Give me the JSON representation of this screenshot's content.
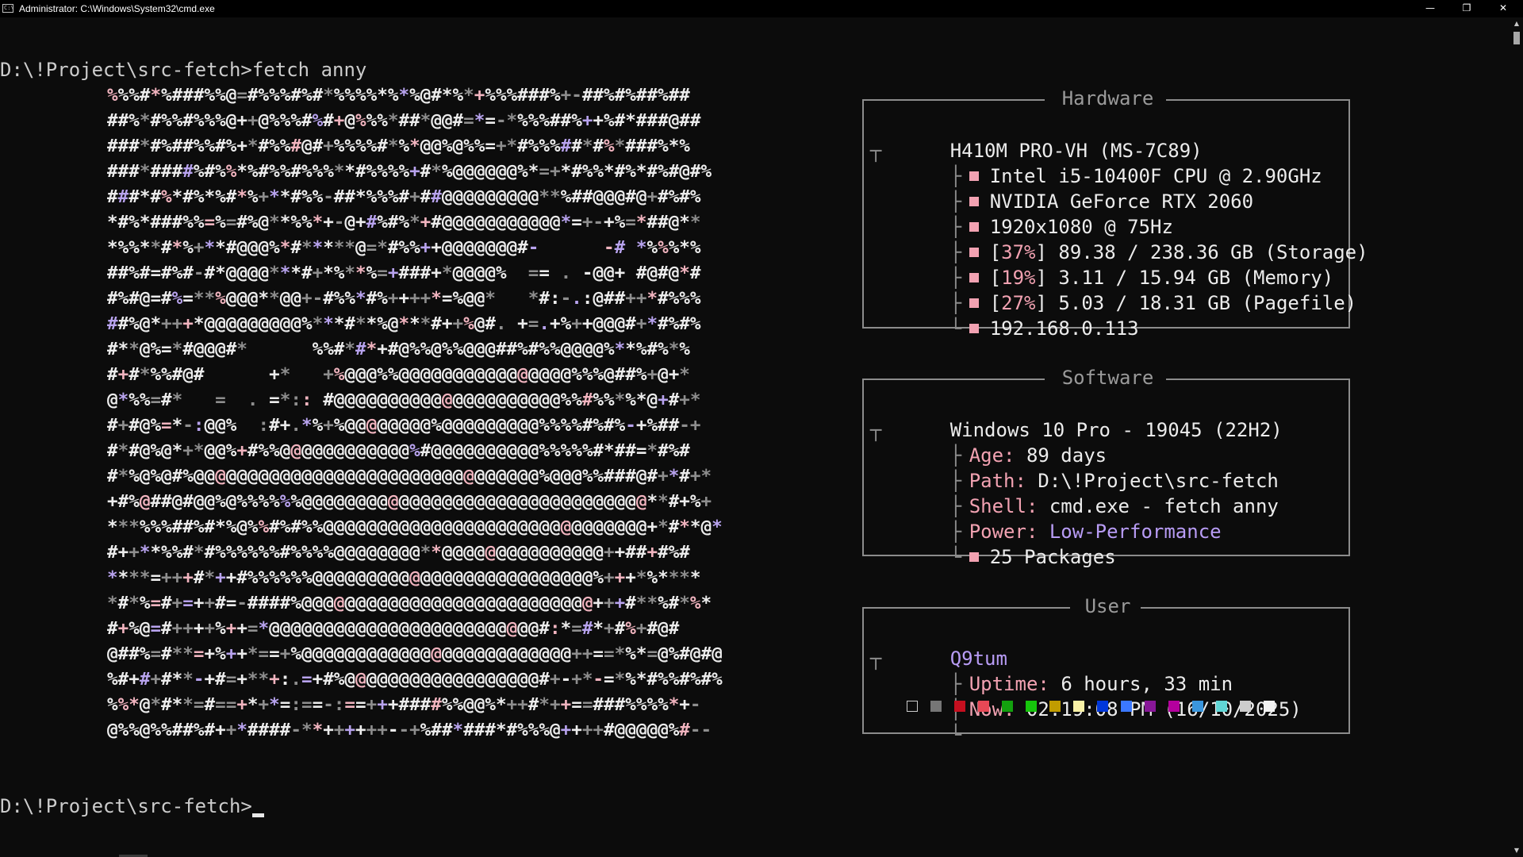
{
  "window": {
    "title": "Administrator: C:\\Windows\\System32\\cmd.exe",
    "icon_text": "C:\\",
    "minimize_icon": "minimize-icon",
    "maximize_icon": "restore-icon",
    "close_icon": "close-icon",
    "min_glyph": "—",
    "max_glyph": "❐",
    "close_glyph": "✕"
  },
  "terminal": {
    "prompt_line_1": "D:\\!Project\\src-fetch>fetch anny",
    "prompt_line_2": "D:\\!Project\\src-fetch>",
    "colors": {
      "background": "#0c0c0c",
      "text": "#cccccc",
      "pink": "#f2a2b2",
      "lavender": "#b89cf5",
      "gray": "#8c8c8c"
    }
  },
  "ascii_art": {
    "rows": [
      "%%%#*%###%%@=#%%%#%#*%%%%*%*%@#*%*+%%%###%+-##%#%##%##",
      "##%*#%%#%%%@++@%%%#%#+@%%%*##*@@#=*=-*%%%##%++%#*###@##",
      "###*#%##%%#%+*#%%#@#+%%%%#*%*@@%@%%=+*#%%%##*#%*###%*%",
      "###*####%#%%*%#%%#%%%**#%%%%+#*%@@@@@@%*=+*#%%*#%*#%#@#%",
      "###*#%*#%*%#*%+**#%%-##*%%%#+##@@@@@@@@@**%##@@@#@+#%#%",
      "*#%*###%%=%=#%@**%%*+-@+#%#%*+#@@@@@@@@@@@*=+-+%=*##@**",
      "*%%**#*%+**#@@@%*#*****@=*#%%++@@@@@@@#-      -# *%%%*%",
      "##%#=#%#-#*@@@@***#+*%**%=+###+*@@@@%  == . -@@+ #@#@*#",
      "#%#@=#%=**%@@@**@@+-#%%*#%++++*=%@@*   *#:-.:@##++*#%%%",
      "##%@*+++*@@@@@@@@@%***#**%@***#++%@#. +=.+%++@@@#+*#%#%",
      "#**@%=*#@@@#*      %%#*#*+#@%%@%%@@@##%#%%@@@@%**%#%*%",
      "#+#*%%#@#      +*   +%@@@%%@@@@@@@@@@@@@@@@%%%@##%+@+*",
      "@*%%=#*   =  . =*:: #@@@@@@@@@@@@@@@@@@@@@%%#%%*%*@+#+*",
      "#+#@%=*-:@@%  :#+.*%+%@@@@@@@@%@@@@@@@@@%%%%#%#%-+%##-+",
      "#*#@%@*+*@@%+#%%@@@@@@@@@@@@%#@@@@@@@@@@%%%%%#*##=*#%#",
      "#*%@%@#%@@@@@@@@@@@@@@@@@@@@@@@@@@@@@@@@%@@@%%###@#+*#+*",
      "+#%@##@#@@%@%%%%%%@@@@@@@@@@@@@@@@@@@@@@@@@@@@@@@@**#+%+",
      "***%%%##%#*%@%%#%#%%@@@@@@@@@@@@@@@@@@@@@@@@@@@@@@+*#**@*",
      "#++**%%#*#%%%%%%#%%%%@@@@@@@@**@@@@@@@@@@@@@@@++##+#%#",
      "****=+++#*++#%%%%%%@@@@@@@@@@@@@@@@@@@@@@@@@@%+++*%****",
      "*#*%=#+=++#=-####%@@@@@@@@@@@@@@@@@@@@@@@@@@@+++#**%#*%*",
      "#+%@=#++++%++=*@@@@@@@@@@@@@@@@@@@@@@@@@#:*=#*+#%+#@#",
      "@##%=#**=+%++*==+%@@@@@@@@@@@@@@@@@@@@@@@@@++==*%*=@%#@#@",
      "%#+#+#**-+#=+**+:.=+#%@@@@@@@@@@@@@@@@@@#+-+*-=*%*#%%#%#%",
      "%%*@*#**=#==+*+*=:==-:==+++####%%@@%*++#*++==###%%%%*+-",
      "@%%@%%##%#++*####-**++++++--+%##*###*#%%%@++++#@@@@@%#--"
    ],
    "colors": [
      "#ececec",
      "#8e8e8e",
      "#f1b4bf",
      "#b8a3ee"
    ]
  },
  "hardware": {
    "title": "Hardware",
    "board": "H410M PRO-VH (MS-7C89)",
    "cpu": "Intel i5-10400F CPU @ 2.90GHz",
    "gpu": "NVIDIA GeForce RTX 2060",
    "display": "1920x1080 @ 75Hz",
    "storage": {
      "percent": "37%",
      "text": "89.38 / 238.36 GB (Storage)"
    },
    "memory": {
      "percent": "19%",
      "text": "3.11 / 15.94 GB (Memory)"
    },
    "pagefile": {
      "percent": "27%",
      "text": "5.03 / 18.31 GB (Pagefile)"
    },
    "ip": "192.168.0.113"
  },
  "software": {
    "title": "Software",
    "os": "Windows 10 Pro - 19045 (22H2)",
    "age_key": "Age:",
    "age_value": "89 days",
    "path_key": "Path:",
    "path_value": "D:\\!Project\\src-fetch",
    "shell_key": "Shell:",
    "shell_value": "cmd.exe - fetch anny",
    "power_key": "Power:",
    "power_value": "Low-Performance",
    "packages": "25 Packages"
  },
  "user": {
    "title": "User",
    "name": "Q9tum",
    "uptime_key": "Uptime:",
    "uptime_value": "6 hours, 33 min",
    "now_key": "Now:",
    "now_value": "02:19:08 PM (16/10/2025)",
    "palette": [
      "#0c0c0c",
      "#767676",
      "#c50f1f",
      "#e74856",
      "#13a10e",
      "#16c60c",
      "#c19c00",
      "#f9f1a5",
      "#0037da",
      "#3b78ff",
      "#881798",
      "#b4009e",
      "#3a96dd",
      "#61d6d6",
      "#cccccc",
      "#f2f2f2"
    ]
  },
  "glyphs": {
    "branch": "├",
    "branch_last": "└",
    "branch_start": "┬",
    "vertical": "│"
  }
}
